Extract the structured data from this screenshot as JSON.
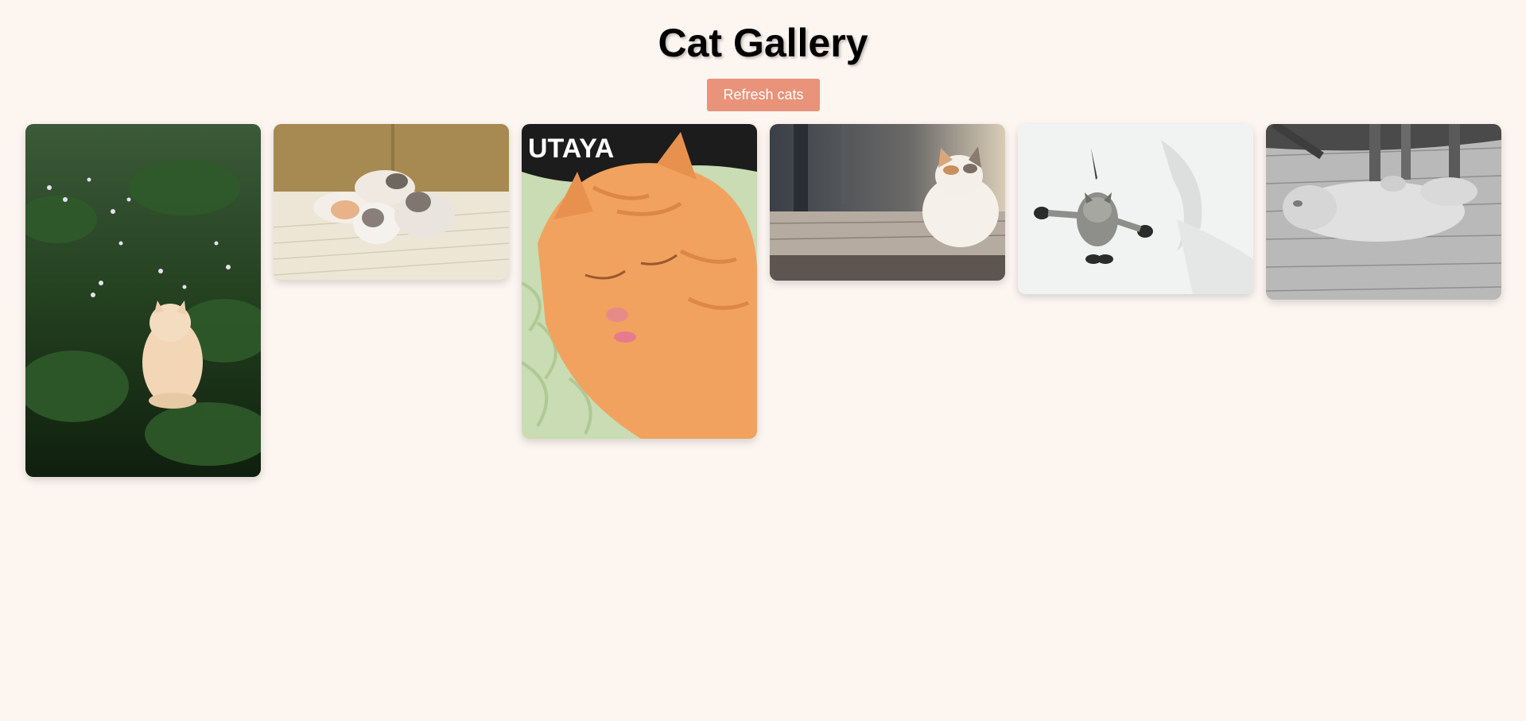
{
  "page": {
    "title": "Cat Gallery",
    "background_color": "#fdf5f0"
  },
  "toolbar": {
    "refresh_label": "Refresh cats",
    "refresh_color": "#e8937a"
  },
  "gallery": {
    "photos": [
      {
        "subject": "long-haired cream cat sitting among green plants and flowers"
      },
      {
        "subject": "three fluffy kittens sleeping on a cream blanket"
      },
      {
        "subject": "orange tabby cat sleeping on a green knitted blanket",
        "text": "UTAYA"
      },
      {
        "subject": "calico cat sitting on a wooden table"
      },
      {
        "subject": "tabby kitten leaping mid-air against a white wall"
      },
      {
        "subject": "grayscale fluffy cat lying on a wooden floor"
      }
    ]
  }
}
